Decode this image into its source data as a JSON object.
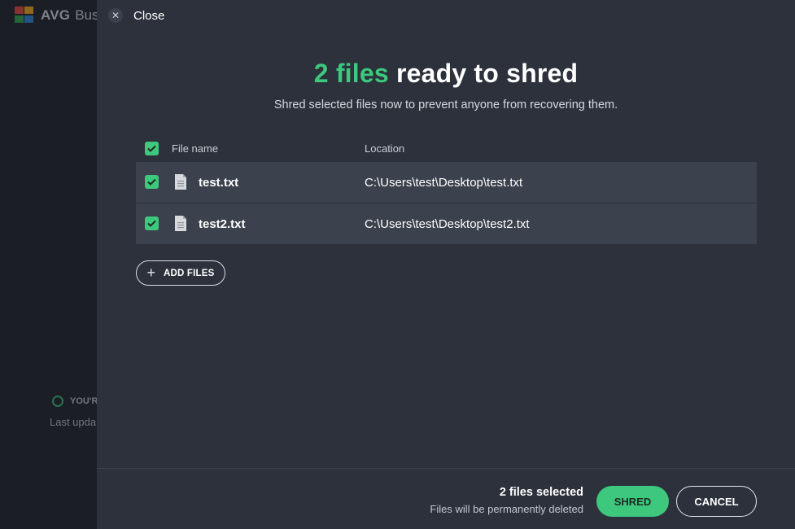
{
  "background_app": {
    "logo_text": "AVG",
    "logo_text_2": "Bus",
    "status_text": "YOU'R",
    "updated_text": "Last upda"
  },
  "dialog": {
    "close_label": "Close",
    "title_highlight": "2 files",
    "title_rest": " ready to shred",
    "subtitle": "Shred selected files now to prevent anyone from recovering them.",
    "table": {
      "headers": {
        "name": "File name",
        "location": "Location"
      },
      "rows": [
        {
          "name": "test.txt",
          "location": "C:\\Users\\test\\Desktop\\test.txt",
          "checked": true
        },
        {
          "name": "test2.txt",
          "location": "C:\\Users\\test\\Desktop\\test2.txt",
          "checked": true
        }
      ]
    },
    "add_files_label": "ADD FILES",
    "footer": {
      "selected_count": "2 files selected",
      "note": "Files will be permanently deleted",
      "shred_label": "SHRED",
      "cancel_label": "CANCEL"
    }
  },
  "colors": {
    "accent_green": "#3ec87d",
    "panel_bg": "#2c313c",
    "row_bg": "#3b414d"
  },
  "icons": {
    "close": "close-icon",
    "checkbox": "checkbox-checked-icon",
    "file": "file-icon",
    "add": "plus-icon"
  }
}
